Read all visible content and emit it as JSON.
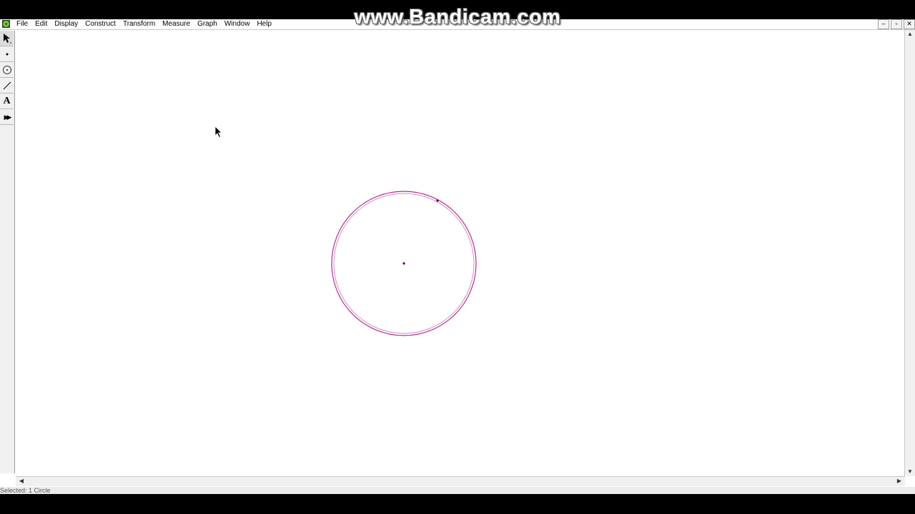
{
  "menubar": {
    "items": [
      "File",
      "Edit",
      "Display",
      "Construct",
      "Transform",
      "Measure",
      "Graph",
      "Window",
      "Help"
    ],
    "controls": {
      "minimize": "–",
      "restore": "▫",
      "close": "✕"
    }
  },
  "toolbox": {
    "tools": [
      "arrow-select-tool",
      "point-tool",
      "compass-tool",
      "straightedge-tool",
      "text-tool",
      "custom-tool"
    ],
    "text_tool_label": "A",
    "custom_tool_label": "▶▶"
  },
  "watermark": "www.Bandicam.com",
  "status": {
    "text": "Selected: 1 Circle"
  },
  "circle": {
    "color": "#b0308f",
    "point_color": "#6a0020",
    "selected": true
  },
  "scrollbars": {
    "up": "▲",
    "down": "▼",
    "left": "◀",
    "right": "▶"
  }
}
